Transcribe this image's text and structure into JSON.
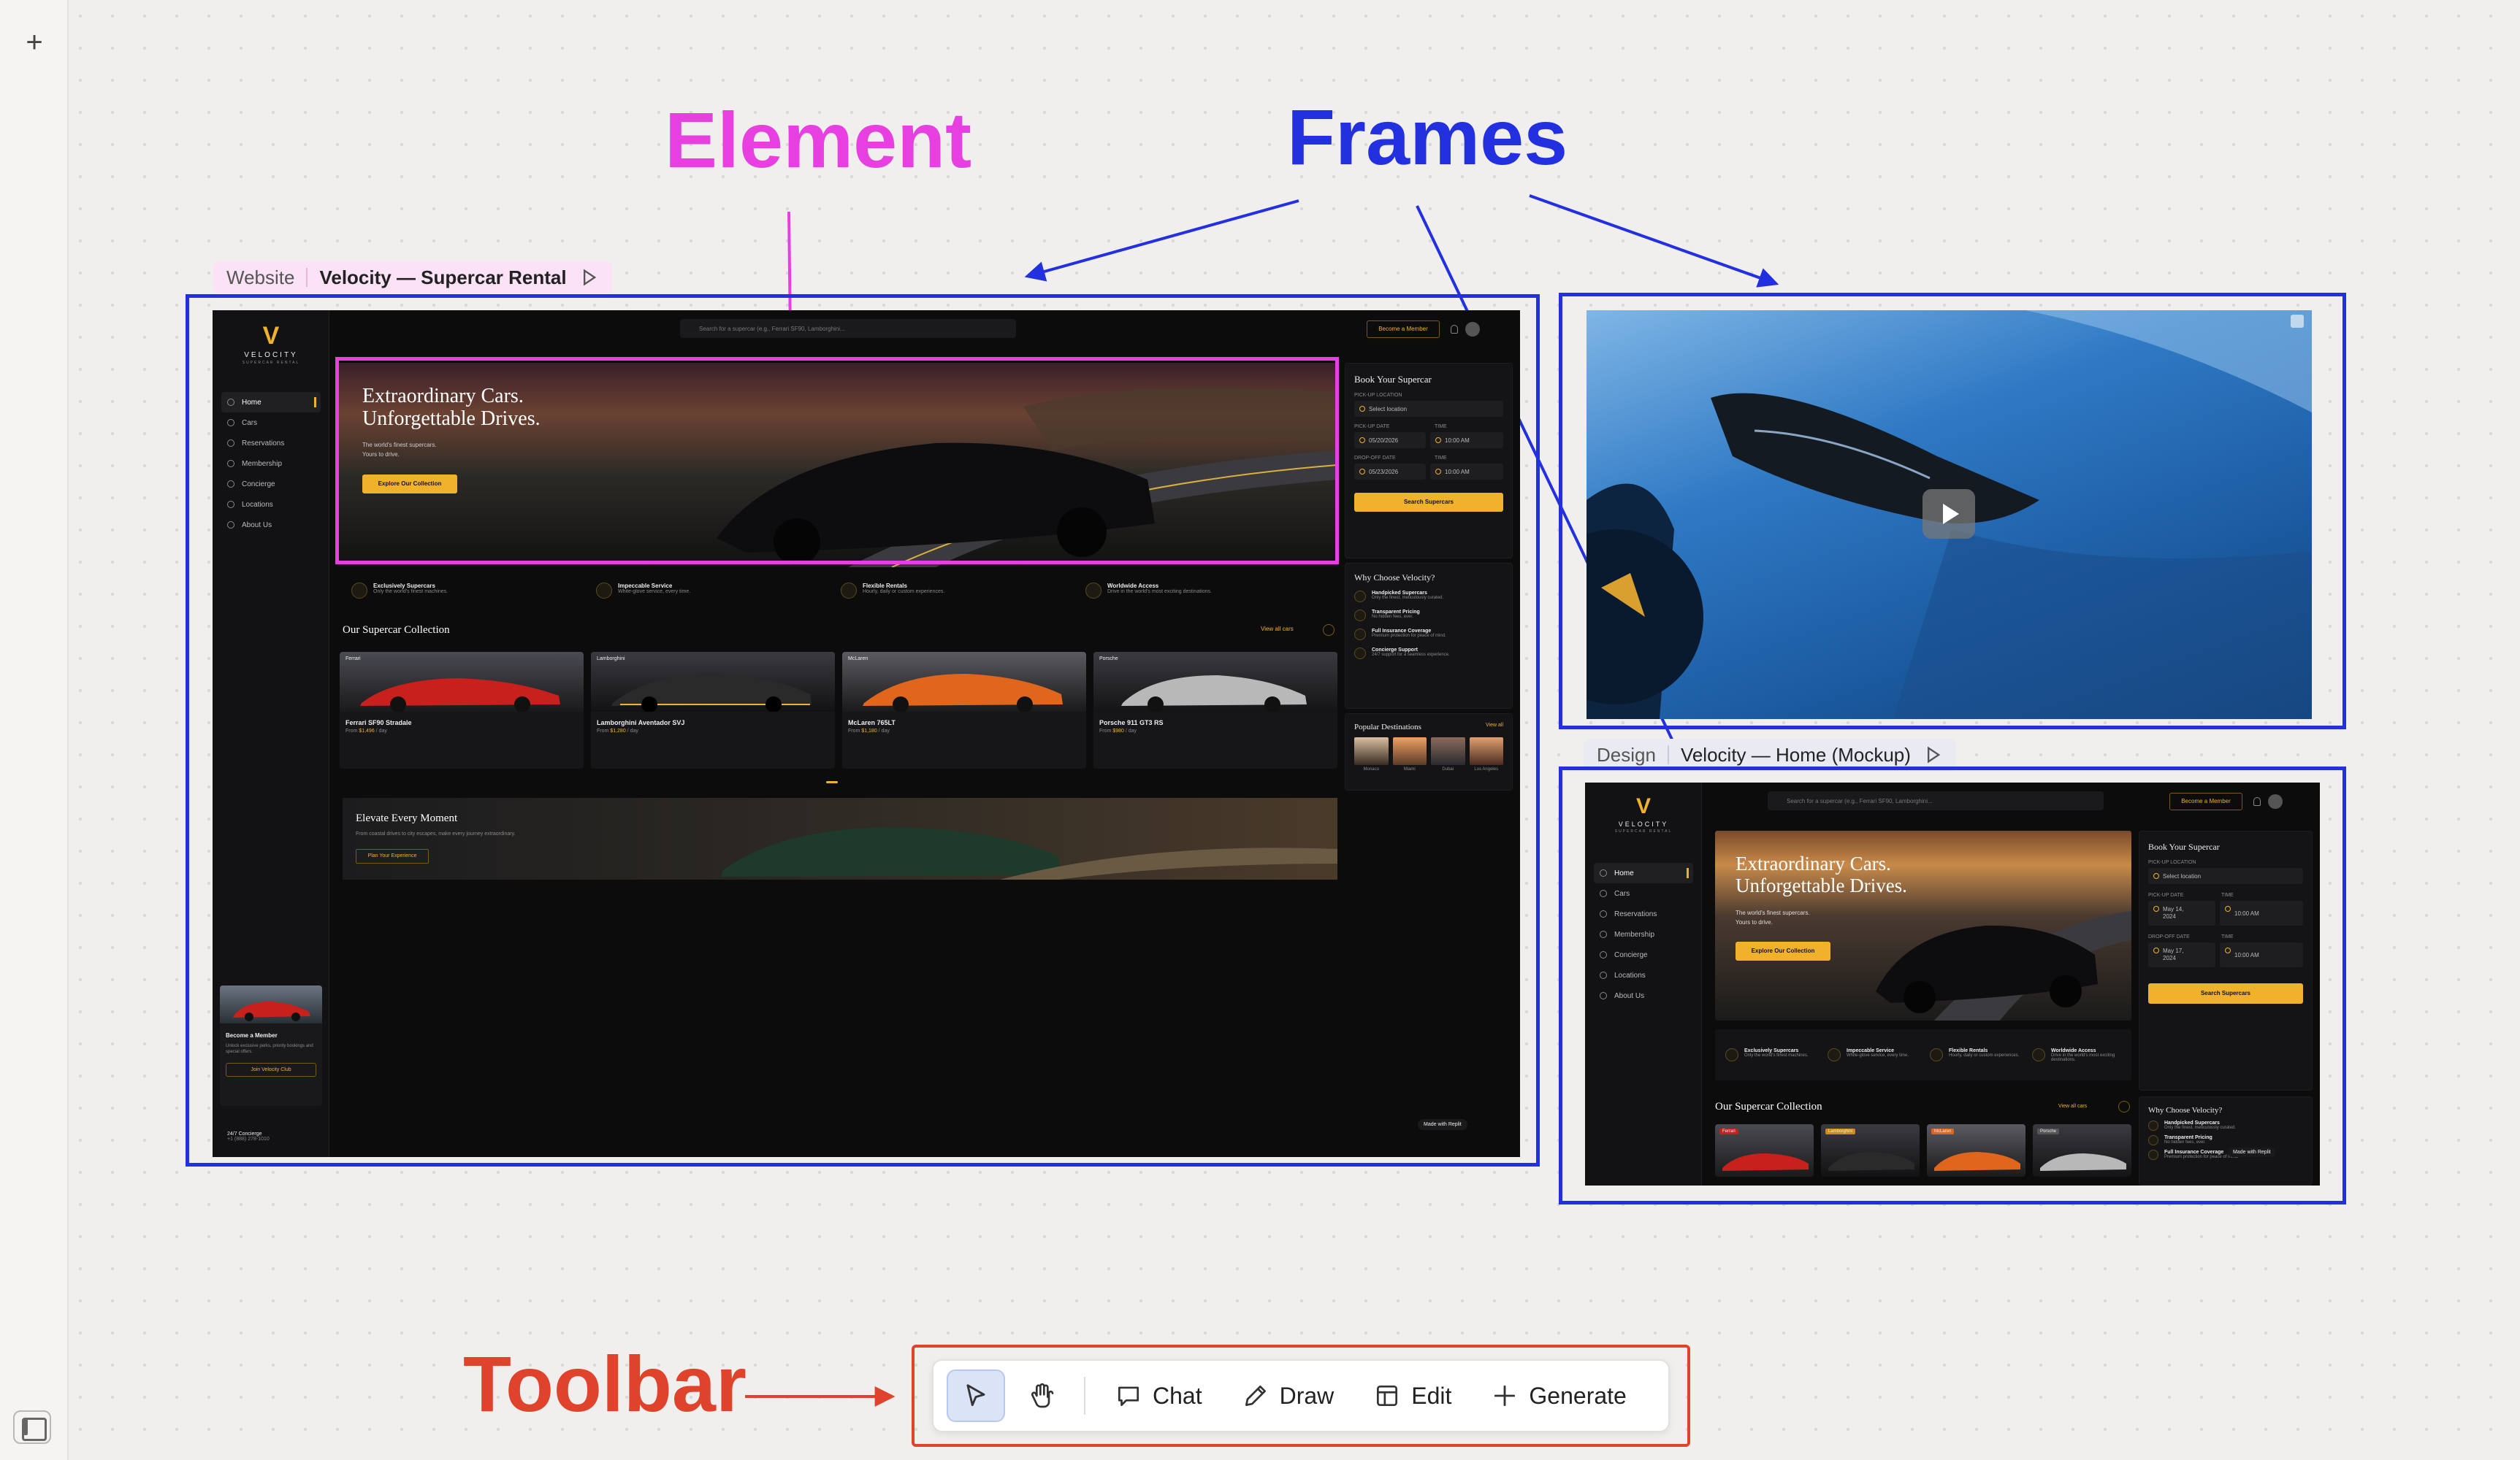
{
  "annotations": {
    "element": "Element",
    "frames": "Frames",
    "toolbar": "Toolbar",
    "colors": {
      "element": "#e83fe0",
      "frames": "#2230e0",
      "toolbar": "#e0432b"
    }
  },
  "frame1": {
    "label_kind": "Website",
    "label_title": "Velocity — Supercar Rental"
  },
  "frame3": {
    "label_kind": "Design",
    "label_title": "Velocity — Home (Mockup)"
  },
  "site": {
    "brand": "VELOCITY",
    "brand_sub": "SUPERCAR RENTAL",
    "search_placeholder": "Search for a supercar (e.g., Ferrari SF90, Lamborghini...",
    "member_button": "Become a Member",
    "nav": [
      "Home",
      "Cars",
      "Reservations",
      "Membership",
      "Concierge",
      "Locations",
      "About Us"
    ],
    "hero_title_1": "Extraordinary Cars.",
    "hero_title_2": "Unforgettable Drives.",
    "hero_sub_1": "The world's finest supercars.",
    "hero_sub_2": "Yours to drive.",
    "hero_cta": "Explore Our Collection",
    "features": [
      {
        "title": "Exclusively Supercars",
        "desc": "Only the world's finest machines."
      },
      {
        "title": "Impeccable Service",
        "desc": "White-glove service, every time."
      },
      {
        "title": "Flexible Rentals",
        "desc": "Hourly, daily or custom experiences."
      },
      {
        "title": "Worldwide Access",
        "desc": "Drive in the world's most exciting destinations."
      }
    ],
    "collection_title": "Our Supercar Collection",
    "view_all": "View all cars",
    "cars": [
      {
        "brand": "Ferrari",
        "name": "Ferrari SF90 Stradale",
        "price": "$1,496",
        "color": "#c8201c"
      },
      {
        "brand": "Lamborghini",
        "name": "Lamborghini Aventador SVJ",
        "price": "$1,280",
        "color": "#2a2a2a"
      },
      {
        "brand": "McLaren",
        "name": "McLaren 765LT",
        "price": "$1,180",
        "color": "#e0661e"
      },
      {
        "brand": "Porsche",
        "name": "Porsche 911 GT3 RS",
        "price": "$980",
        "color": "#b8b8b8"
      }
    ],
    "from_label": "From",
    "per_day": "/ day",
    "elevate_title": "Elevate Every Moment",
    "elevate_sub": "From coastal drives to city escapes, make every journey extraordinary.",
    "elevate_cta": "Plan Your Experience",
    "book_title": "Book Your Supercar",
    "pickup_location_label": "PICK-UP LOCATION",
    "select_location": "Select location",
    "pickup_date_label": "PICK-UP DATE",
    "time_label": "TIME",
    "dropoff_date_label": "DROP-OFF DATE",
    "pickup_date": "05/20/2026",
    "dropoff_date": "05/23/2026",
    "time_value": "10:00 AM",
    "search_button": "Search Supercars",
    "why_title": "Why Choose Velocity?",
    "why": [
      {
        "title": "Handpicked Supercars",
        "desc": "Only the finest, meticulously curated."
      },
      {
        "title": "Transparent Pricing",
        "desc": "No hidden fees, ever."
      },
      {
        "title": "Full Insurance Coverage",
        "desc": "Premium protection for peace of mind."
      },
      {
        "title": "Concierge Support",
        "desc": "24/7 support for a seamless experience."
      }
    ],
    "destinations_title": "Popular Destinations",
    "view_all_short": "View all",
    "destinations": [
      "Monaco",
      "Miami",
      "Dubai",
      "Los Angeles"
    ],
    "side_card_title": "Become a Member",
    "side_card_desc": "Unlock exclusive perks, priority bookings and special offers.",
    "side_card_cta": "Join Velocity Club",
    "concierge": "24/7 Concierge",
    "concierge_phone": "+1 (888) 278-1010",
    "made_with": "Made with Replit"
  },
  "mockup": {
    "date1": "May 14, 2024",
    "date2": "May 17, 2024"
  },
  "toolbar": {
    "items": [
      {
        "label": "",
        "icon": "pointer-icon",
        "selected": true
      },
      {
        "label": "",
        "icon": "hand-icon"
      },
      {
        "label": "Chat",
        "icon": "chat-icon"
      },
      {
        "label": "Draw",
        "icon": "pencil-icon"
      },
      {
        "label": "Edit",
        "icon": "layout-icon"
      },
      {
        "label": "Generate",
        "icon": "plus-icon"
      }
    ]
  }
}
